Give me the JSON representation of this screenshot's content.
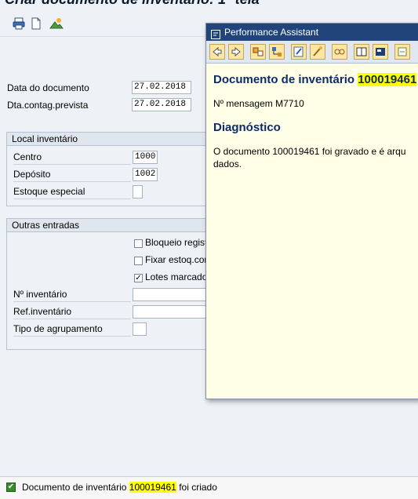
{
  "window": {
    "title": "Criar documento de inventário: 1ª tela"
  },
  "toolbar": {
    "icons": [
      "print-icon",
      "new-document-icon",
      "image-icon"
    ]
  },
  "form": {
    "doc_date_label": "Data do documento",
    "doc_date_value": "27.02.2018",
    "count_date_label": "Dta.contag.prevista",
    "count_date_value": "27.02.2018"
  },
  "local_group": {
    "title": "Local inventário",
    "centro_label": "Centro",
    "centro_value": "1000",
    "deposito_label": "Depósito",
    "deposito_value": "1002",
    "estoque_label": "Estoque especial",
    "estoque_value": ""
  },
  "outras_group": {
    "title": "Outras entradas",
    "checkboxes": [
      {
        "label": "Bloqueio regist",
        "checked": false
      },
      {
        "label": "Fixar estoq.con",
        "checked": false
      },
      {
        "label": "Lotes marcado",
        "checked": true
      }
    ],
    "inventario_label": "Nº inventário",
    "inventario_value": "",
    "ref_label": "Ref.inventário",
    "ref_value": "",
    "tipo_label": "Tipo de agrupamento",
    "tipo_value": ""
  },
  "popup": {
    "title": "Performance Assistant",
    "heading_prefix": "Documento de inventário",
    "heading_number": "100019461",
    "message_number": "Nº mensagem M7710",
    "section_title": "Diagnóstico",
    "body_line1": "O documento 100019461 foi gravado e é arqu",
    "body_line2": "dados."
  },
  "status": {
    "prefix": "Documento de inventário",
    "number": "100019461",
    "suffix": "foi criado",
    "check_mark": "✔"
  }
}
